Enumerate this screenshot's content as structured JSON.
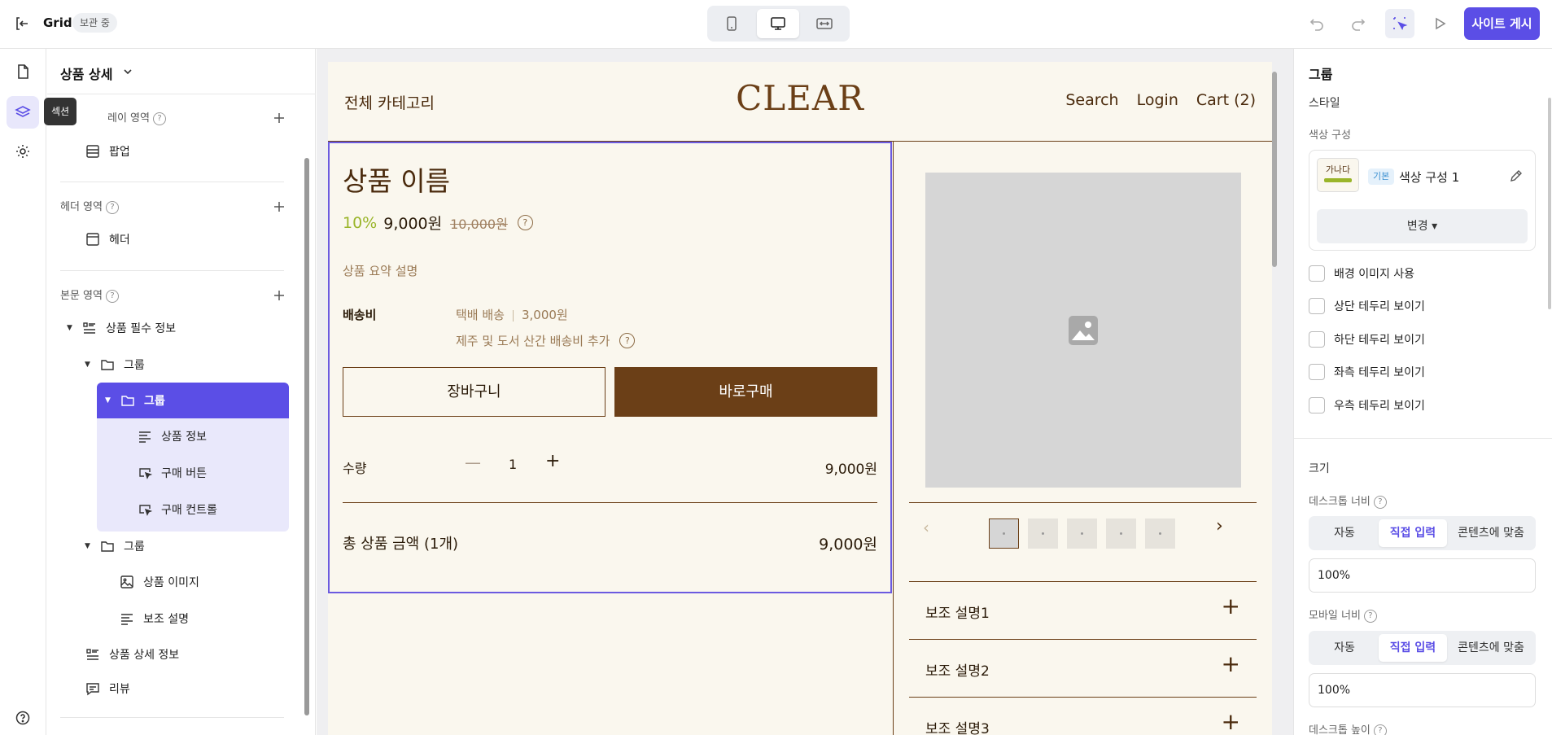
{
  "topbar": {
    "title": "Grid",
    "badge": "보관 중",
    "publish_label": "사이트 게시"
  },
  "rail": {
    "tooltip": "섹션"
  },
  "layers": {
    "title": "상품 상세",
    "sections": {
      "overlay": "레이 영역",
      "header": "헤더 영역",
      "body": "본문 영역"
    },
    "items": {
      "popup": "팝업",
      "header": "헤더",
      "product_required": "상품 필수 정보",
      "group1": "그룹",
      "group2": "그룹",
      "product_info": "상품 정보",
      "buy_button": "구매 버튼",
      "buy_control": "구매 컨트롤",
      "group3": "그룹",
      "product_image": "상품 이미지",
      "sub_desc": "보조 설명",
      "product_detail": "상품 상세 정보",
      "review": "리뷰"
    }
  },
  "site": {
    "category": "전체 카테고리",
    "logo": "CLEAR",
    "nav": [
      "Search",
      "Login",
      "Cart (2)"
    ],
    "product": {
      "name": "상품 이름",
      "discount": "10%",
      "price": "9,000원",
      "old_price": "10,000원",
      "help": "?",
      "summary": "상품 요약 설명",
      "shipping_label": "배송비",
      "shipping_method": "택배 배송",
      "shipping_fee": "3,000원",
      "shipping_extra": "제주 및 도서 산간 배송비 추가",
      "cart_label": "장바구니",
      "buy_label": "바로구매",
      "qty_label": "수량",
      "qty_minus": "—",
      "qty_value": "1",
      "qty_plus": "+",
      "qty_price": "9,000원",
      "total_label": "총 상품 금액 (1개)",
      "total_value": "9,000원"
    },
    "gallery": {
      "prev": "‹",
      "next": "›"
    },
    "accordion": [
      "보조 설명1",
      "보조 설명2",
      "보조 설명3"
    ]
  },
  "props": {
    "title": "그룹",
    "style_label": "스타일",
    "color_set_label": "색상 구성",
    "swatch_text": "가나다",
    "swatch_tag": "기본",
    "color_set_name": "색상 구성 1",
    "change_label": "변경 ▾",
    "checkboxes": [
      "배경 이미지 사용",
      "상단 테두리 보이기",
      "하단 테두리 보이기",
      "좌측 테두리 보이기",
      "우측 테두리 보이기"
    ],
    "size_label": "크기",
    "desktop_width_label": "데스크톱 너비",
    "mobile_width_label": "모바일 너비",
    "desktop_height_label": "데스크톱 높이",
    "seg_options": [
      "자동",
      "직접 입력",
      "콘텐츠에 맞춤"
    ],
    "desktop_width_value": "100%",
    "mobile_width_value": "100%"
  },
  "colors": {
    "accent": "#5b4ee6",
    "brand_brown": "#6b3f17",
    "site_bg": "#faf7ee",
    "discount_green": "#9ab52a"
  }
}
